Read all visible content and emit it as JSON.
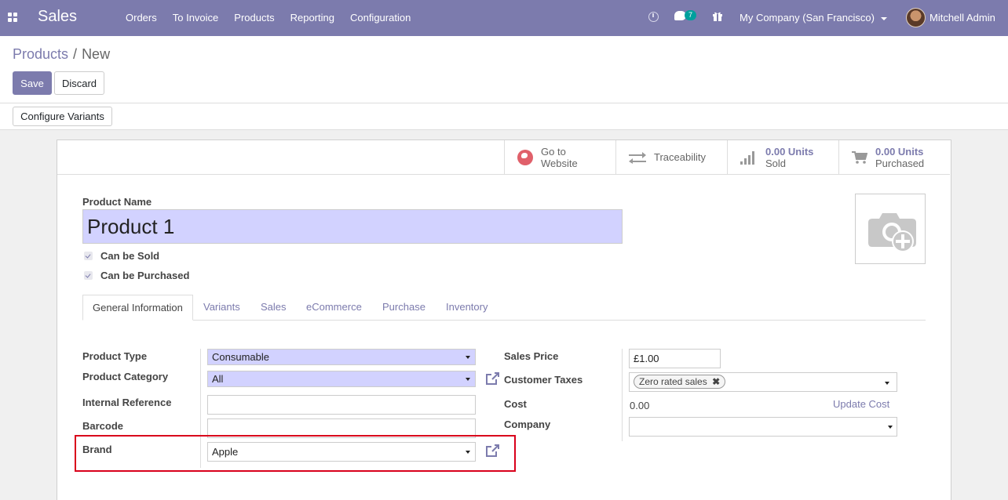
{
  "navbar": {
    "app_name": "Sales",
    "menu": [
      "Orders",
      "To Invoice",
      "Products",
      "Reporting",
      "Configuration"
    ],
    "messages_count": "7",
    "company": "My Company (San Francisco)",
    "user": "Mitchell Admin"
  },
  "breadcrumb": {
    "parent": "Products",
    "current": "New"
  },
  "actions": {
    "save": "Save",
    "discard": "Discard",
    "configure_variants": "Configure Variants"
  },
  "smart_buttons": {
    "website": {
      "line1": "Go to",
      "line2": "Website"
    },
    "traceability": "Traceability",
    "sold": {
      "value": "0.00 Units",
      "label": "Sold"
    },
    "purchased": {
      "value": "0.00 Units",
      "label": "Purchased"
    }
  },
  "product": {
    "name_label": "Product Name",
    "name": "Product 1",
    "can_be_sold": "Can be Sold",
    "can_be_purchased": "Can be Purchased"
  },
  "tabs": [
    "General Information",
    "Variants",
    "Sales",
    "eCommerce",
    "Purchase",
    "Inventory"
  ],
  "general": {
    "product_type": {
      "label": "Product Type",
      "value": "Consumable"
    },
    "product_category": {
      "label": "Product Category",
      "value": "All"
    },
    "internal_reference": {
      "label": "Internal Reference",
      "value": ""
    },
    "barcode": {
      "label": "Barcode",
      "value": ""
    },
    "brand": {
      "label": "Brand",
      "value": "Apple"
    },
    "sales_price": {
      "label": "Sales Price",
      "value": "£1.00"
    },
    "customer_taxes": {
      "label": "Customer Taxes",
      "tag": "Zero rated sales"
    },
    "cost": {
      "label": "Cost",
      "value": "0.00",
      "update_link": "Update Cost"
    },
    "company": {
      "label": "Company",
      "value": ""
    }
  },
  "colors": {
    "primary": "#7c7bad",
    "required_bg": "#d2d2ff",
    "highlight": "#d9001b"
  }
}
